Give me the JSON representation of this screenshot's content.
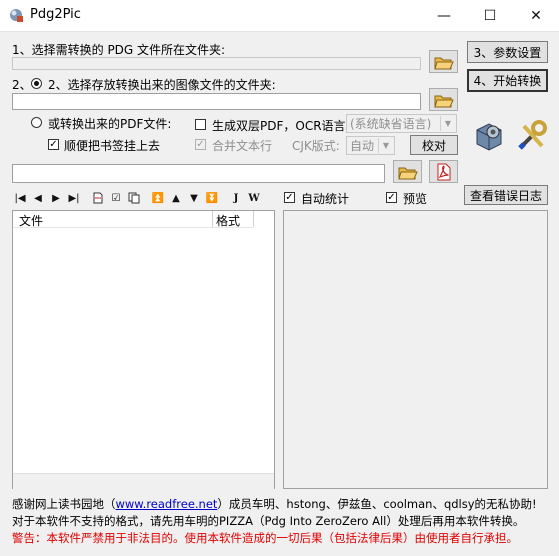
{
  "window": {
    "title": "Pdg2Pic"
  },
  "titlebar": {
    "minimize": "—",
    "maximize": "☐",
    "close": "✕"
  },
  "step1": {
    "label": "1、选择需转换的 PDG 文件所在文件夹:",
    "value": ""
  },
  "step2": {
    "label": "2、选择存放转换出来的图像文件的文件夹:",
    "value": ""
  },
  "pdf": {
    "radio_label": "或转换出来的PDF文件:",
    "bookmark_label": "顺便把书签挂上去",
    "dual_label": "生成双层PDF，OCR语言:",
    "ocr_language": "(系统缺省语言)",
    "merge_label": "合并文本行",
    "cjk_label": "CJK版式:",
    "cjk_value": "自动",
    "check_button": "校对",
    "output_value": ""
  },
  "buttons": {
    "params": "3、参数设置",
    "start": "4、开始转换",
    "error_log": "查看错误日志"
  },
  "toggles": {
    "auto_stat": "自动统计",
    "preview": "预览"
  },
  "table": {
    "columns": [
      "文件",
      "格式"
    ],
    "rows": []
  },
  "footer": {
    "line1_a": "感谢网上读书园地（",
    "line1_link": "www.readfree.net",
    "line1_b": "）成员车明、hstong、伊兹鱼、coolman、qdlsy的无私协助!",
    "line2": "对于本软件不支持的格式，请先用车明的PIZZA（Pdg Into ZeroZero All）处理后再用本软件转换。",
    "line3": "警告：本软件严禁用于非法目的。使用本软件造成的一切后果（包括法律后果）由使用者自行承担。"
  }
}
